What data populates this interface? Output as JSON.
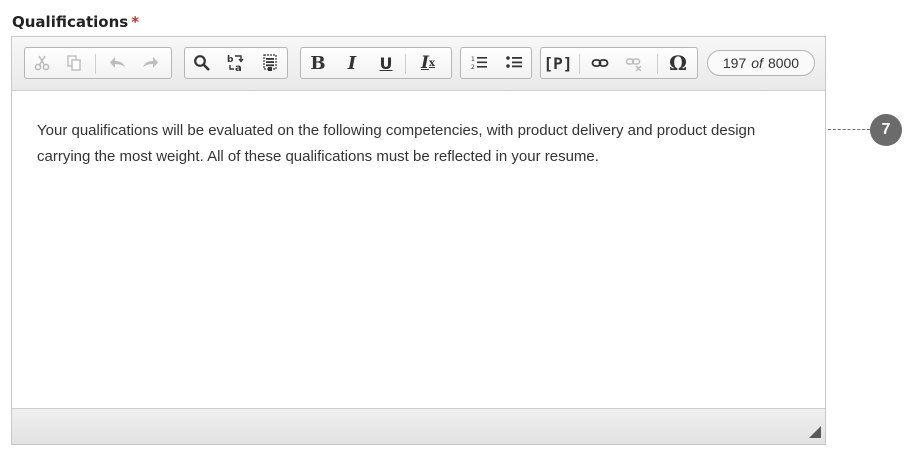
{
  "field": {
    "label": "Qualifications",
    "required_mark": "*"
  },
  "toolbar": {
    "cut": {
      "icon": "scissors-icon"
    },
    "copy": {
      "icon": "copy-icon"
    },
    "undo": {
      "icon": "undo-icon"
    },
    "redo": {
      "icon": "redo-icon"
    },
    "find": {
      "icon": "magnifier-icon"
    },
    "replace": {
      "icon": "find-replace-icon"
    },
    "select_all": {
      "icon": "select-all-icon"
    },
    "bold": "B",
    "italic": "I",
    "underline": "U",
    "remove_format": "I",
    "remove_format_sub": "x",
    "ordered_list": {
      "icon": "numbered-list-icon"
    },
    "bullet_list": {
      "icon": "bulleted-list-icon"
    },
    "paragraph": "[P]",
    "link": {
      "icon": "link-icon"
    },
    "unlink": {
      "icon": "unlink-icon"
    },
    "special_char": "Ω",
    "counter": {
      "current": "197",
      "of": "of",
      "max": "8000"
    }
  },
  "content": {
    "text": "Your qualifications will be evaluated on the following competencies, with product delivery and product design carrying the most weight. All of these qualifications must be reflected in your resume."
  },
  "callout": {
    "number": "7"
  },
  "colors": {
    "callout_bg": "#6b6b6b",
    "required": "#c0392b"
  }
}
